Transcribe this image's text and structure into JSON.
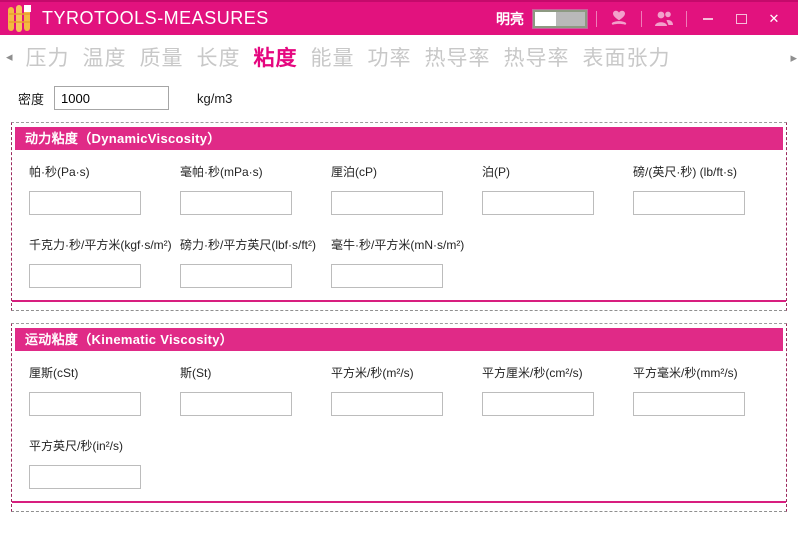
{
  "window": {
    "title": "TYROTOOLS-MEASURES"
  },
  "titlebar": {
    "theme_label": "明亮",
    "toggle_state": "left",
    "icons": {
      "donate": "hands-holding-heart",
      "users": "two-people",
      "minimize": "—",
      "maximize": "▢",
      "close": "✕"
    }
  },
  "tabbar": {
    "prev_arrow": "◂",
    "next_arrow": "▸",
    "tabs": [
      {
        "label": "压力",
        "active": false
      },
      {
        "label": "温度",
        "active": false
      },
      {
        "label": "质量",
        "active": false
      },
      {
        "label": "长度",
        "active": false
      },
      {
        "label": "粘度",
        "active": true
      },
      {
        "label": "能量",
        "active": false
      },
      {
        "label": "功率",
        "active": false
      },
      {
        "label": "热导率",
        "active": false
      },
      {
        "label": "热导率",
        "active": false
      },
      {
        "label": "表面张力",
        "active": false
      }
    ]
  },
  "density": {
    "label": "密度",
    "value": "1000",
    "unit": "kg/m3"
  },
  "sections": [
    {
      "title": "动力粘度（DynamicViscosity）",
      "fields": [
        "帕·秒(Pa·s)",
        "毫帕·秒(mPa·s)",
        "厘泊(cP)",
        "泊(P)",
        "磅/(英尺·秒) (lb/ft·s)",
        "千克力·秒/平方米(kgf·s/m²)",
        "磅力·秒/平方英尺(lbf·s/ft²)",
        "毫牛·秒/平方米(mN·s/m²)"
      ],
      "values": [
        "",
        "",
        "",
        "",
        "",
        "",
        "",
        ""
      ]
    },
    {
      "title": "运动粘度（Kinematic Viscosity）",
      "fields": [
        "厘斯(cSt)",
        "斯(St)",
        "平方米/秒(m²/s)",
        "平方厘米/秒(cm²/s)",
        "平方毫米/秒(mm²/s)",
        "平方英尺/秒(in²/s)"
      ],
      "values": [
        "",
        "",
        "",
        "",
        "",
        ""
      ]
    }
  ],
  "colors": {
    "titlebar": "#e2127e",
    "titlebar_border": "#c40a6b",
    "section_header": "#e02a87",
    "section_bottom_line": "#d81e7f",
    "active_tab": "#e5067f",
    "inactive_tab": "#c8c8c8",
    "logo_yellow": "#f4b942"
  }
}
